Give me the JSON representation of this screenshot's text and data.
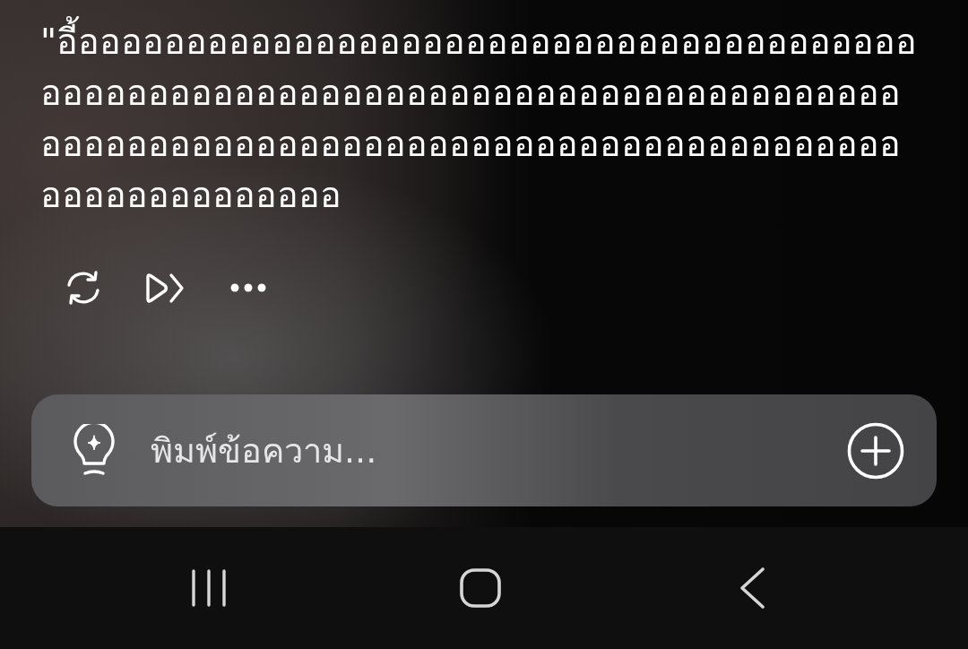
{
  "message": {
    "text": "\"อี้อออออออออออออออออออออออออออออออออออออออออออออออออออออออออออออออออออออออออออออออออออออออออออออออออออออออออออออออออออออออออออออออออออออ"
  },
  "composer": {
    "placeholder": "พิมพ์ข้อความ..."
  }
}
